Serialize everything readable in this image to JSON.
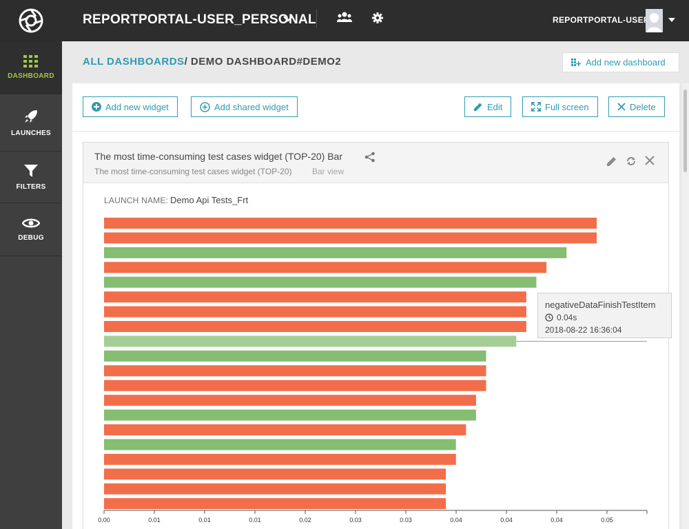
{
  "sidebar": {
    "items": [
      {
        "label": "DASHBOARD",
        "icon": "grid-icon"
      },
      {
        "label": "LAUNCHES",
        "icon": "rocket-icon"
      },
      {
        "label": "FILTERS",
        "icon": "filter-icon"
      },
      {
        "label": "DEBUG",
        "icon": "eye-icon"
      }
    ]
  },
  "header": {
    "project": "REPORTPORTAL-USER_PERSONAL",
    "user": "REPORTPORTAL-USER"
  },
  "breadcrumb": {
    "root": "ALL DASHBOARDS",
    "current": "/ DEMO DASHBOARD#DEMO2"
  },
  "buttons": {
    "add_dashboard": "Add new dashboard",
    "add_widget": "Add new widget",
    "add_shared_widget": "Add shared widget",
    "edit": "Edit",
    "full_screen": "Full screen",
    "delete": "Delete"
  },
  "widget": {
    "title": "The most time-consuming test cases widget (TOP-20) Bar",
    "subtitle": "The most time-consuming test cases widget (TOP-20)",
    "view": "Bar view",
    "launch_label": "LAUNCH NAME:",
    "launch_value": "Demo Api Tests_Frt"
  },
  "tooltip": {
    "name": "negativeDataFinishTestItem",
    "duration": "0.04s",
    "date": "2018-08-22 16:36:04"
  },
  "colors": {
    "failed": "#f26e4b",
    "passed": "#85bd73",
    "accent": "#2f9bb0",
    "active_nav": "#a3c644"
  },
  "chart_data": {
    "type": "bar",
    "orientation": "horizontal",
    "xlim": [
      0,
      0.054
    ],
    "x_ticks": [
      "0.00",
      "0.01",
      "0.01",
      "0.01",
      "0.02",
      "0.03",
      "0.03",
      "0.04",
      "0.04",
      "0.04",
      "0.05"
    ],
    "bars": [
      {
        "value": 0.049,
        "status": "failed"
      },
      {
        "value": 0.049,
        "status": "failed"
      },
      {
        "value": 0.046,
        "status": "passed"
      },
      {
        "value": 0.044,
        "status": "failed"
      },
      {
        "value": 0.043,
        "status": "passed"
      },
      {
        "value": 0.042,
        "status": "failed"
      },
      {
        "value": 0.042,
        "status": "failed"
      },
      {
        "value": 0.042,
        "status": "failed"
      },
      {
        "value": 0.041,
        "status": "passed",
        "highlighted": true
      },
      {
        "value": 0.038,
        "status": "passed"
      },
      {
        "value": 0.038,
        "status": "failed"
      },
      {
        "value": 0.038,
        "status": "failed"
      },
      {
        "value": 0.037,
        "status": "failed"
      },
      {
        "value": 0.037,
        "status": "passed"
      },
      {
        "value": 0.036,
        "status": "failed"
      },
      {
        "value": 0.035,
        "status": "passed"
      },
      {
        "value": 0.035,
        "status": "failed"
      },
      {
        "value": 0.034,
        "status": "failed"
      },
      {
        "value": 0.034,
        "status": "failed"
      },
      {
        "value": 0.034,
        "status": "failed"
      }
    ]
  }
}
